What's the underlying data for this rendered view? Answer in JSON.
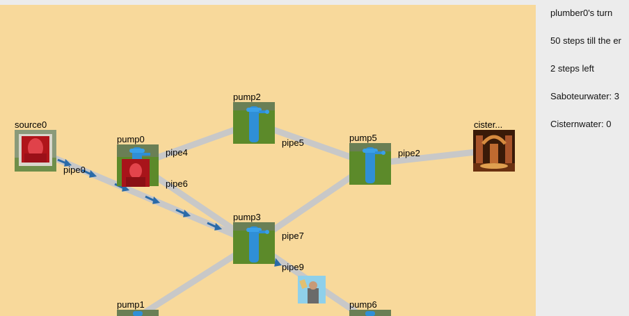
{
  "status": {
    "turn": "plumber0's turn",
    "steps_till_end": "50 steps till the er",
    "steps_left": "2 steps left",
    "saboteur_water": "Saboteurwater: 3",
    "cistern_water": "Cisternwater: 0"
  },
  "nodes": {
    "source0": "source0",
    "pump0": "pump0",
    "pump1": "pump1",
    "pump2": "pump2",
    "pump3": "pump3",
    "pump5": "pump5",
    "pump6": "pump6",
    "cistern": "cister..."
  },
  "pipes": {
    "pipe0": "pipe0",
    "pipe2": "pipe2",
    "pipe4": "pipe4",
    "pipe5": "pipe5",
    "pipe6": "pipe6",
    "pipe7": "pipe7",
    "pipe9": "pipe9"
  },
  "colors": {
    "board": "#f8d99b",
    "pipe": "#c8c8c8",
    "water_arrow": "#2a6aa8",
    "pump_blue": "#2f8fd6",
    "grass": "#5c8a2a"
  }
}
